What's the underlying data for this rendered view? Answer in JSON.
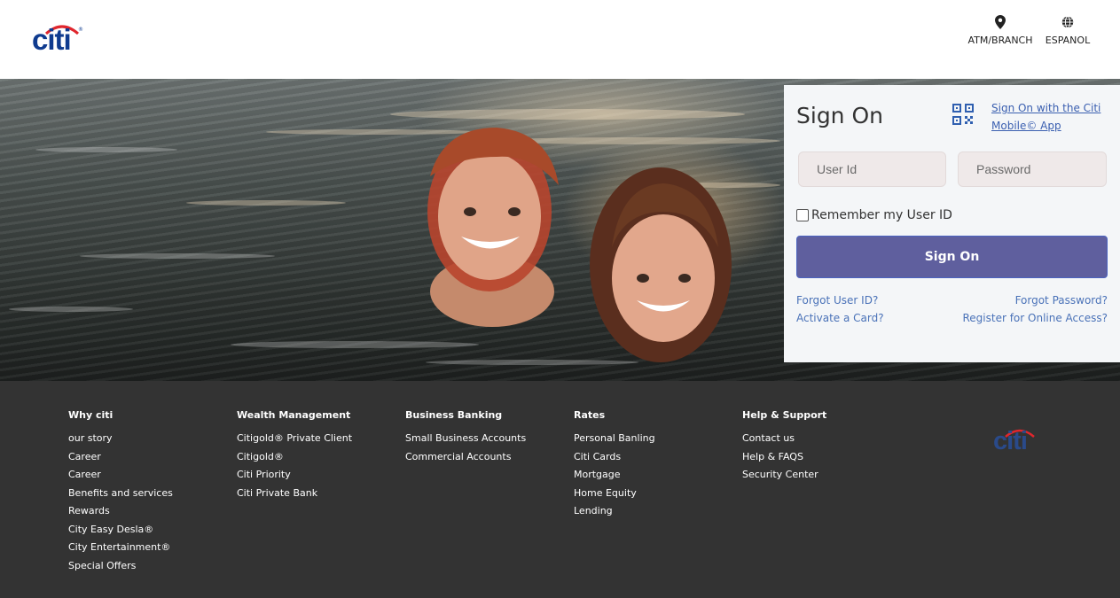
{
  "header": {
    "logo_text": "citi",
    "logo_reg": "®",
    "atm_label": "ATM/BRANCH",
    "espanol_label": "ESPANOL"
  },
  "signon": {
    "title": "Sign On",
    "app_link": "Sign On with the Citi Mobile© App",
    "user_placeholder": "User Id",
    "password_placeholder": "Password",
    "remember_label": "Remember my User ID",
    "button_label": "Sign On",
    "forgot_user": "Forgot User ID?",
    "forgot_password": "Forgot Password?",
    "activate_card": "Activate a Card?",
    "register": "Register for Online Access?"
  },
  "colors": {
    "brand_blue": "#0f3b8f",
    "citi_red": "#e0262d",
    "button": "#5f5f9e",
    "footer_bg": "#333333",
    "link": "#4a72b8"
  },
  "footer": {
    "logo_text": "citi",
    "columns": [
      {
        "heading": "Why citi",
        "items": [
          "our story",
          "Career",
          "Career",
          "Benefits and services",
          "Rewards",
          "City Easy Desla®",
          "City Entertainment®",
          "Special Offers"
        ]
      },
      {
        "heading": "Wealth Management",
        "items": [
          "Citigold® Private Client",
          "Citigold®",
          "Citi Priority",
          "Citi Private Bank"
        ]
      },
      {
        "heading": "Business Banking",
        "items": [
          "Small Business Accounts",
          "Commercial Accounts"
        ]
      },
      {
        "heading": "Rates",
        "items": [
          "Personal Banling",
          "Citi Cards",
          "Mortgage",
          "Home Equity",
          "Lending"
        ]
      },
      {
        "heading": "Help & Support",
        "items": [
          "Contact us",
          "Help & FAQS",
          "Security Center"
        ]
      }
    ]
  }
}
